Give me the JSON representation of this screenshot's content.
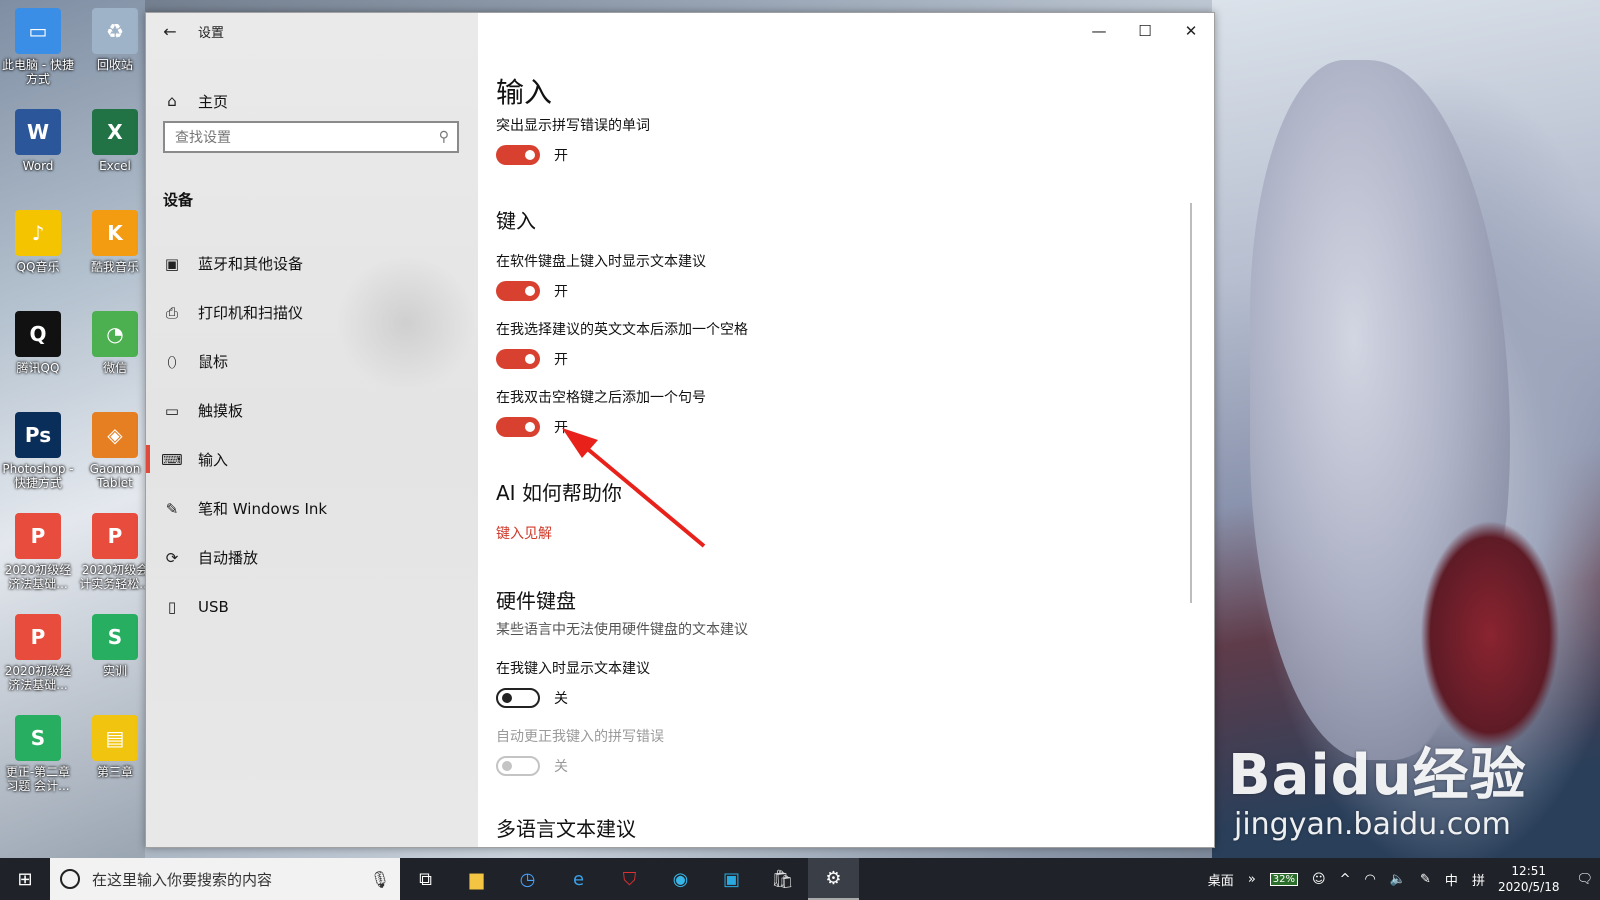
{
  "window": {
    "title": "设置",
    "back_glyph": "←",
    "minimize_glyph": "—",
    "maximize_glyph": "☐",
    "close_glyph": "✕"
  },
  "sidebar": {
    "home_label": "主页",
    "search_placeholder": "查找设置",
    "section": "设备",
    "items": [
      {
        "label": "蓝牙和其他设备",
        "icon": "bluetooth-devices-icon",
        "glyph": "▣"
      },
      {
        "label": "打印机和扫描仪",
        "icon": "printer-icon",
        "glyph": "⎙"
      },
      {
        "label": "鼠标",
        "icon": "mouse-icon",
        "glyph": "⬯"
      },
      {
        "label": "触摸板",
        "icon": "touchpad-icon",
        "glyph": "▭"
      },
      {
        "label": "输入",
        "icon": "keyboard-icon",
        "glyph": "⌨",
        "active": true
      },
      {
        "label": "笔和 Windows Ink",
        "icon": "pen-icon",
        "glyph": "✎"
      },
      {
        "label": "自动播放",
        "icon": "autoplay-icon",
        "glyph": "⟳"
      },
      {
        "label": "USB",
        "icon": "usb-icon",
        "glyph": "▯"
      }
    ]
  },
  "content": {
    "title": "输入",
    "spell": {
      "label": "突出显示拼写错误的单词",
      "state": "开"
    },
    "typing": {
      "heading": "键入",
      "suggest_soft": {
        "label": "在软件键盘上键入时显示文本建议",
        "state": "开"
      },
      "add_space": {
        "label": "在我选择建议的英文文本后添加一个空格",
        "state": "开"
      },
      "double_space": {
        "label": "在我双击空格键之后添加一个句号",
        "state": "开"
      }
    },
    "ai": {
      "heading": "AI 如何帮助你",
      "link": "键入见解"
    },
    "hardware": {
      "heading": "硬件键盘",
      "desc": "某些语言中无法使用硬件键盘的文本建议",
      "suggest_hw": {
        "label": "在我键入时显示文本建议",
        "state": "关"
      },
      "autocorrect": {
        "label": "自动更正我键入的拼写错误",
        "state": "关"
      }
    },
    "multilang_heading": "多语言文本建议"
  },
  "desktop_icons": [
    {
      "label": "此电脑 - 快捷方式",
      "color": "#3a8ee6",
      "glyph": "▭"
    },
    {
      "label": "回收站",
      "color": "#9fb3c8",
      "glyph": "♻"
    },
    {
      "label": "Word",
      "color": "#2b579a",
      "glyph": "W"
    },
    {
      "label": "Excel",
      "color": "#217346",
      "glyph": "X"
    },
    {
      "label": "QQ音乐",
      "color": "#f5c400",
      "glyph": "♪"
    },
    {
      "label": "酷我音乐",
      "color": "#f39c12",
      "glyph": "K"
    },
    {
      "label": "腾讯QQ",
      "color": "#111111",
      "glyph": "Q"
    },
    {
      "label": "微信",
      "color": "#4caf50",
      "glyph": "◔"
    },
    {
      "label": "Photoshop - 快捷方式",
      "color": "#0a2e5a",
      "glyph": "Ps"
    },
    {
      "label": "Gaomon Tablet",
      "color": "#e67e22",
      "glyph": "◈"
    },
    {
      "label": "2020初级经济法基础...",
      "color": "#e74c3c",
      "glyph": "P"
    },
    {
      "label": "2020初级会计实务轻松...",
      "color": "#e74c3c",
      "glyph": "P"
    },
    {
      "label": "2020初级经济法基础...",
      "color": "#e74c3c",
      "glyph": "P"
    },
    {
      "label": "实训",
      "color": "#27ae60",
      "glyph": "S"
    },
    {
      "label": "更正-第二章习题 会计...",
      "color": "#27ae60",
      "glyph": "S"
    },
    {
      "label": "第三章",
      "color": "#f1c40f",
      "glyph": "▤"
    }
  ],
  "watermark": {
    "big": "Baidu经验",
    "small": "jingyan.baidu.com"
  },
  "taskbar": {
    "search_placeholder": "在这里输入你要搜索的内容",
    "desktop_label": "桌面",
    "battery": "32%",
    "ime": "中",
    "time": "12:51",
    "date": "2020/5/18"
  },
  "colors": {
    "accent": "#d8402f",
    "link": "#d03a2a",
    "taskbar": "#1f2329"
  }
}
